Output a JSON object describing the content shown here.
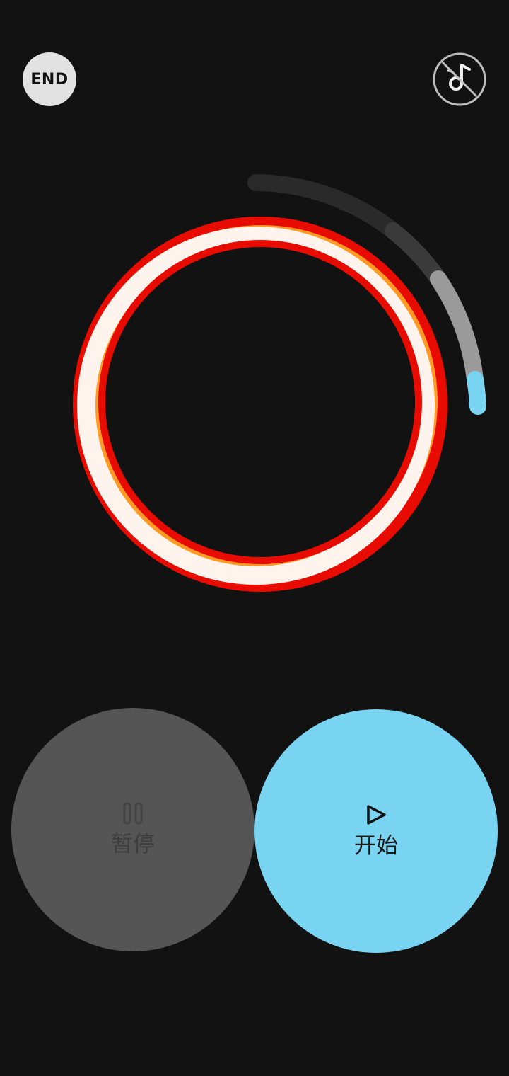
{
  "header": {
    "end_label": "END",
    "music_icon": "music-off-icon"
  },
  "timer": {
    "progress_arc_colors": [
      "#2a2a2a",
      "#3a3a3a",
      "#9a9a9a",
      "#78d4f1"
    ],
    "ring_colors": [
      "#e80c00",
      "#ff9a22",
      "#fff3ee"
    ]
  },
  "controls": {
    "pause": {
      "label": "暂停",
      "icon": "pause-icon",
      "color": "#555555"
    },
    "start": {
      "label": "开始",
      "icon": "play-icon",
      "color": "#78d4f1"
    }
  }
}
